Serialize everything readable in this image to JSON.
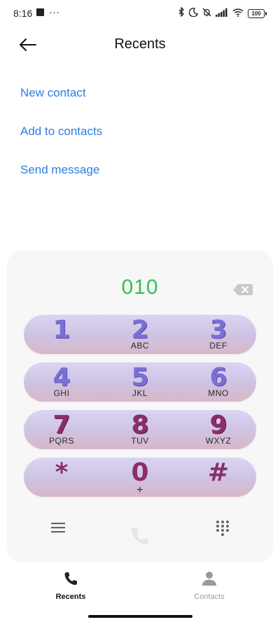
{
  "status_bar": {
    "time": "8:16",
    "more": "···",
    "battery": "100"
  },
  "header": {
    "title": "Recents"
  },
  "actions": [
    {
      "label": "New contact"
    },
    {
      "label": "Add to contacts"
    },
    {
      "label": "Send message"
    }
  ],
  "dialer": {
    "number": "010",
    "rows": [
      [
        {
          "digit": "1",
          "letters": ""
        },
        {
          "digit": "2",
          "letters": "ABC"
        },
        {
          "digit": "3",
          "letters": "DEF"
        }
      ],
      [
        {
          "digit": "4",
          "letters": "GHI"
        },
        {
          "digit": "5",
          "letters": "JKL"
        },
        {
          "digit": "6",
          "letters": "MNO"
        }
      ],
      [
        {
          "digit": "7",
          "letters": "PQRS"
        },
        {
          "digit": "8",
          "letters": "TUV"
        },
        {
          "digit": "9",
          "letters": "WXYZ"
        }
      ],
      [
        {
          "digit": "*",
          "letters": ""
        },
        {
          "digit": "0",
          "letters": "+"
        },
        {
          "digit": "#",
          "letters": ""
        }
      ]
    ],
    "accent_color": "#33c155"
  },
  "bottom_nav": [
    {
      "label": "Recents",
      "icon": "phone-icon"
    },
    {
      "label": "Contacts",
      "icon": "person-icon"
    }
  ],
  "colors": {
    "link": "#2d7de2",
    "number": "#33c155"
  }
}
